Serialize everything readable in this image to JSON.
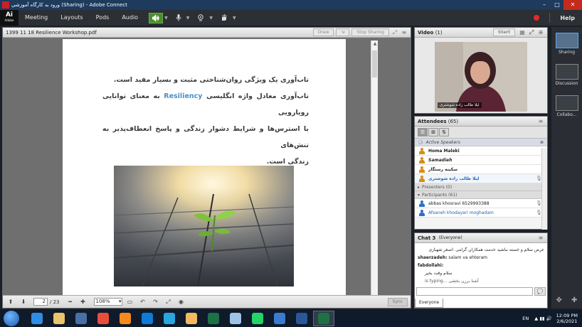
{
  "window": {
    "title": "ورود به کارگاه آموزشی (Sharing) - Adobe Connect",
    "minimize": "–",
    "maximize": "□",
    "close": "✕"
  },
  "menubar": {
    "logo_top": "Ai",
    "logo_bottom": "Adobe",
    "items": [
      "Meeting",
      "Layouts",
      "Pods",
      "Audio"
    ],
    "help": "Help"
  },
  "share_pod": {
    "title": "1399 11 18 Resilience Workshop.pdf",
    "draw_label": "Draw",
    "stop_sharing_label": "Stop Sharing",
    "document": {
      "line1": "تاب‌آوری یک ویژگی روان‌شناختی مثبت و بسیار مفید است.",
      "line2_a": "تاب‌آوری معادل واژه انگلیسی ",
      "line2_hl": "Resiliency",
      "line2_b": " به معنای توانایی رویارویی",
      "line3": "با استرس‌ها و شرایط دشوار زندگی و پاسخ انعطاف‌پذیر به تنش‌های",
      "line4": "زندگی است."
    },
    "footer": {
      "current_page": "2",
      "total_pages": "/ 23",
      "zoom": "108%",
      "sync_label": "Sync"
    }
  },
  "video_pod": {
    "title": "Video",
    "count": "(1)",
    "start_label": "Start",
    "participant_name": "لیلا طالب زاده شوشتری"
  },
  "attendees_pod": {
    "title": "Attendees",
    "count": "(65)",
    "active_speakers_label": "Active Speakers",
    "hosts": [
      {
        "name": "Homa Maleki",
        "style": "normal"
      },
      {
        "name": "Samadieh",
        "style": "italic"
      },
      {
        "name": "سکینه رستگار",
        "style": "normal"
      },
      {
        "name": "لیلا طالب زاده شوشتری",
        "style": "blue"
      }
    ],
    "presenters_label": "Presenters (0)",
    "participants_label": "Participants (61)",
    "participants": [
      {
        "name": "abbas khosravi 6529993388"
      },
      {
        "name": "Afsaneh khodayari moghadam"
      }
    ]
  },
  "chat_pod": {
    "title": "Chat",
    "count": "3",
    "scope": "(Everyone)",
    "messages": [
      {
        "sender": "",
        "text": "عرض سلام و خسته نباشید خدمت همکاران گرامی :اصغر شهبازی"
      },
      {
        "sender": "shaerzadeh:",
        "text": "salam  va ehteram"
      },
      {
        "sender": "fabdollahi:",
        "text": ""
      },
      {
        "sender": "",
        "text": "سلام وقت بخیر"
      },
      {
        "sender": "",
        "text": "is typing... آشنا برزن بخشی"
      }
    ],
    "tab_label": "Everyone"
  },
  "layouts": [
    {
      "label": "Sharing",
      "active": true
    },
    {
      "label": "Discussion",
      "active": false
    },
    {
      "label": "Collabo...",
      "active": false
    }
  ],
  "taskbar": {
    "language": "EN",
    "time": "12:09 PM",
    "date": "2/6/2021",
    "apps": [
      {
        "name": "ie",
        "color": "#2f8de4"
      },
      {
        "name": "explorer",
        "color": "#e9c46a"
      },
      {
        "name": "media",
        "color": "#4a6fa5"
      },
      {
        "name": "chrome",
        "color": "#e94e3c"
      },
      {
        "name": "firefox",
        "color": "#f58a1f"
      },
      {
        "name": "teamviewer",
        "color": "#0e7bd6"
      },
      {
        "name": "edge",
        "color": "#2aa6df"
      },
      {
        "name": "paint",
        "color": "#f4b860"
      },
      {
        "name": "excel",
        "color": "#1e7145"
      },
      {
        "name": "notepad",
        "color": "#9ec3e6"
      },
      {
        "name": "whatsapp",
        "color": "#25d366"
      },
      {
        "name": "files",
        "color": "#3b7bd0"
      },
      {
        "name": "word",
        "color": "#2b579a"
      },
      {
        "name": "adobe-connect",
        "color": "#1e7145"
      }
    ]
  },
  "colors": {
    "accent": "#4a8f2e",
    "record": "#e62a2a",
    "titlebar": "#1e3a5c"
  }
}
